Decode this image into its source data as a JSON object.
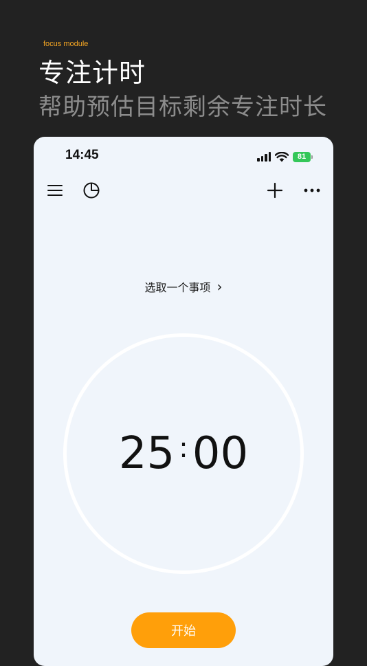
{
  "promo": {
    "tag": "focus module",
    "title": "专注计时",
    "subtitle": "帮助预估目标剩余专注时长"
  },
  "status_bar": {
    "time": "14:45",
    "battery": "81"
  },
  "toolbar": {
    "icons": [
      "menu-icon",
      "pie-chart-icon",
      "plus-icon",
      "more-icon"
    ]
  },
  "task": {
    "select_label": "选取一个事项",
    "chevron": "›"
  },
  "timer": {
    "minutes": "25",
    "separator": ":",
    "seconds": "00"
  },
  "actions": {
    "start_label": "开始"
  },
  "colors": {
    "background": "#222222",
    "accent": "#FF9F0A",
    "tag": "#F5A623",
    "phone_bg": "#F0F5FB",
    "battery": "#34C759"
  }
}
